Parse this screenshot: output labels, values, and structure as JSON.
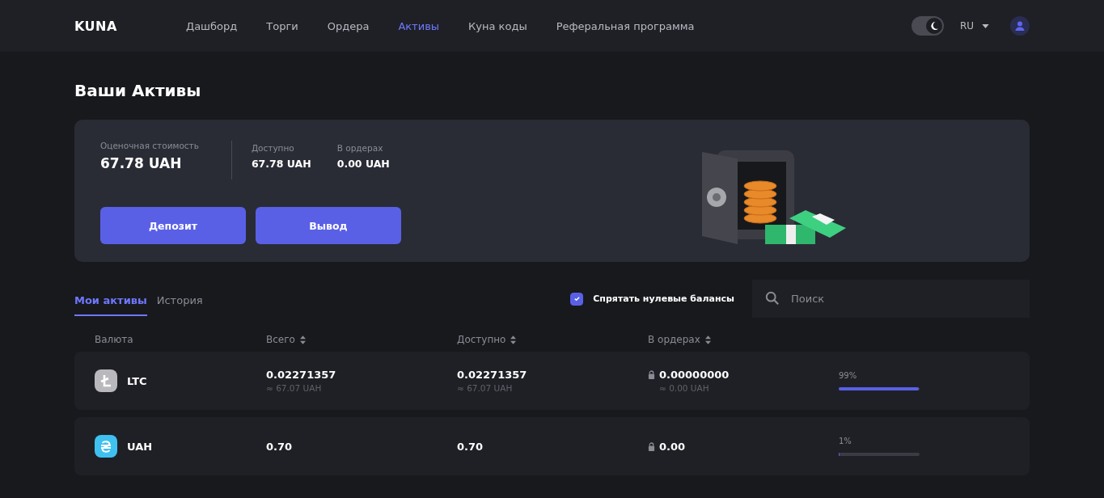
{
  "header": {
    "logo": "KUNA",
    "nav": [
      {
        "label": "Дашборд",
        "selected": false
      },
      {
        "label": "Торги",
        "selected": false
      },
      {
        "label": "Ордера",
        "selected": false
      },
      {
        "label": "Активы",
        "selected": true
      },
      {
        "label": "Куна коды",
        "selected": false
      },
      {
        "label": "Реферальная программа",
        "selected": false
      }
    ],
    "dark_mode": {
      "on": true
    },
    "language": "RU"
  },
  "page_title": "Ваши Активы",
  "summary": {
    "estimated": {
      "label": "Оценочная стоимость",
      "value": "67.78 UAH"
    },
    "available": {
      "label": "Доступно",
      "value": "67.78 UAH"
    },
    "in_orders": {
      "label": "В ордерах",
      "value": "0.00 UAH"
    },
    "buttons": [
      "Депозит",
      "Вывод"
    ]
  },
  "tabs": [
    {
      "label": "Мои активы",
      "selected": true
    },
    {
      "label": "История",
      "selected": false
    }
  ],
  "hide_zero": {
    "label": "Спрятать нулевые балансы",
    "checked": true
  },
  "search": {
    "placeholder": "Поиск"
  },
  "table": {
    "columns": [
      {
        "label": "Валюта",
        "sortable": false
      },
      {
        "label": "Всего",
        "sortable": true
      },
      {
        "label": "Доступно",
        "sortable": true
      },
      {
        "label": "В ордерах",
        "sortable": true
      }
    ],
    "rows": [
      {
        "currency": "LTC",
        "kind": "ltc",
        "total": "0.02271357",
        "total_uah": "≈ 67.07 UAH",
        "available": "0.02271357",
        "available_uah": "≈ 67.07 UAH",
        "in_orders": "0.00000000",
        "in_orders_uah": "≈ 0.00 UAH",
        "share": "99%",
        "level": 0.99
      },
      {
        "currency": "UAH",
        "kind": "uah",
        "total": "0.70",
        "available": "0.70",
        "in_orders": "0.00",
        "share": "1%",
        "level": 0.01
      }
    ]
  }
}
